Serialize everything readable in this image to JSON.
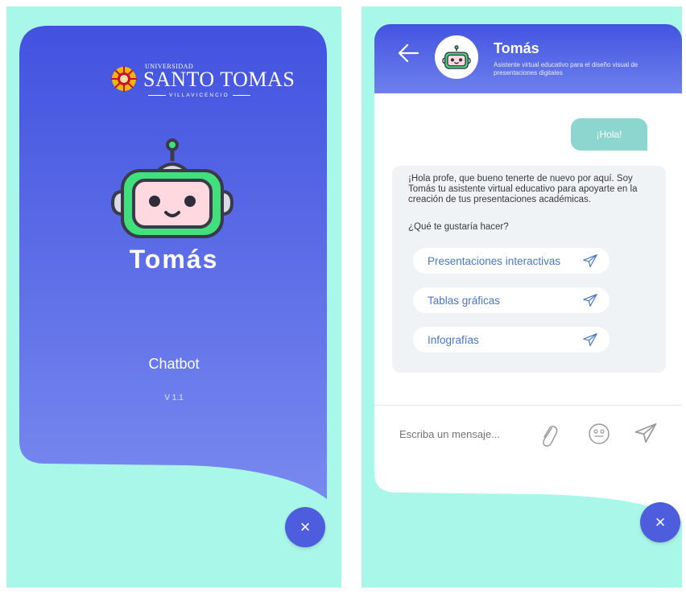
{
  "splash": {
    "university_top": "UNIVERSIDAD",
    "university_name": "SANTO TOMAS",
    "university_city": "VILLAVICENCIO",
    "bot_name": "Tomás",
    "subtitle": "Chatbot",
    "version": "V 1.1",
    "close_icon": "×"
  },
  "chat": {
    "header": {
      "name": "Tomás",
      "description": "Asistente virtual educativo para el diseño visual de presentaciones digitales"
    },
    "user_message": "¡Hola!",
    "bot_message": "¡Hola profe, que bueno tenerte de nuevo por aquí. Soy Tomás tu asistente virtual educativo para apoyarte en la creación de tus presentaciones académicas.",
    "question": "¿Qué te gustaría hacer?",
    "options": [
      {
        "label": "Presentaciones interactivas"
      },
      {
        "label": "Tablas gráficas"
      },
      {
        "label": "Infografías"
      }
    ],
    "input_placeholder": "Escriba un mensaje...",
    "close_icon": "×"
  },
  "colors": {
    "mint": "#a9f7e9",
    "blue_top": "#4354e0",
    "blue_bottom": "#7586ee",
    "fab": "#4d5dde",
    "bubble_out": "#8cd6cf",
    "option_text": "#4a77c4"
  }
}
